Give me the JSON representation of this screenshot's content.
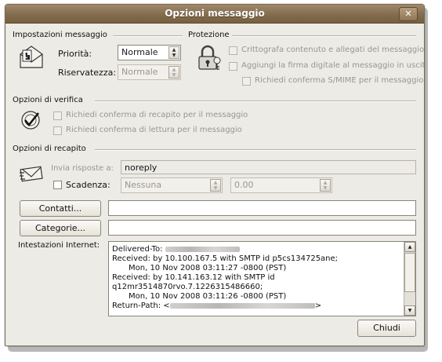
{
  "window": {
    "title": "Opzioni messaggio",
    "close_glyph": "✕"
  },
  "message_settings": {
    "heading": "Impostazioni messaggio",
    "priority_label": "Priorità:",
    "priority_value": "Normale",
    "sensitivity_label": "Riservatezza:",
    "sensitivity_value": "Normale"
  },
  "security": {
    "heading": "Protezione",
    "encrypt_label": "Crittografa contenuto e allegati del messaggio",
    "sign_label": "Aggiungi la firma digitale al messaggio in uscita",
    "smime_label": "Richiedi conferma S/MIME per il messaggio"
  },
  "tracking": {
    "heading": "Opzioni di verifica",
    "delivery_receipt_label": "Richiedi conferma di recapito per il messaggio",
    "read_receipt_label": "Richiedi conferma di lettura per il messaggio"
  },
  "delivery": {
    "heading": "Opzioni di recapito",
    "reply_to_label": "Invia risposte a:",
    "reply_to_value": "noreply",
    "expires_label": "Scadenza:",
    "expires_date": "Nessuna",
    "expires_time": "0.00"
  },
  "contacts_button": "Contatti...",
  "categories_button": "Categorie...",
  "internet_headers": {
    "label": "Intestazioni Internet:",
    "lines": [
      "Delivered-To: ",
      "Received: by 10.100.167.5 with SMTP id p5cs134725ane;",
      "        Mon, 10 Nov 2008 03:11:27 -0800 (PST)",
      "Received: by 10.141.163.12 with SMTP id",
      "q12mr3514870rvo.7.1226315486660;",
      "        Mon, 10 Nov 2008 03:11:26 -0800 (PST)",
      "Return-Path: <"
    ],
    "return_path_suffix": ">"
  },
  "close_button": "Chiudi"
}
